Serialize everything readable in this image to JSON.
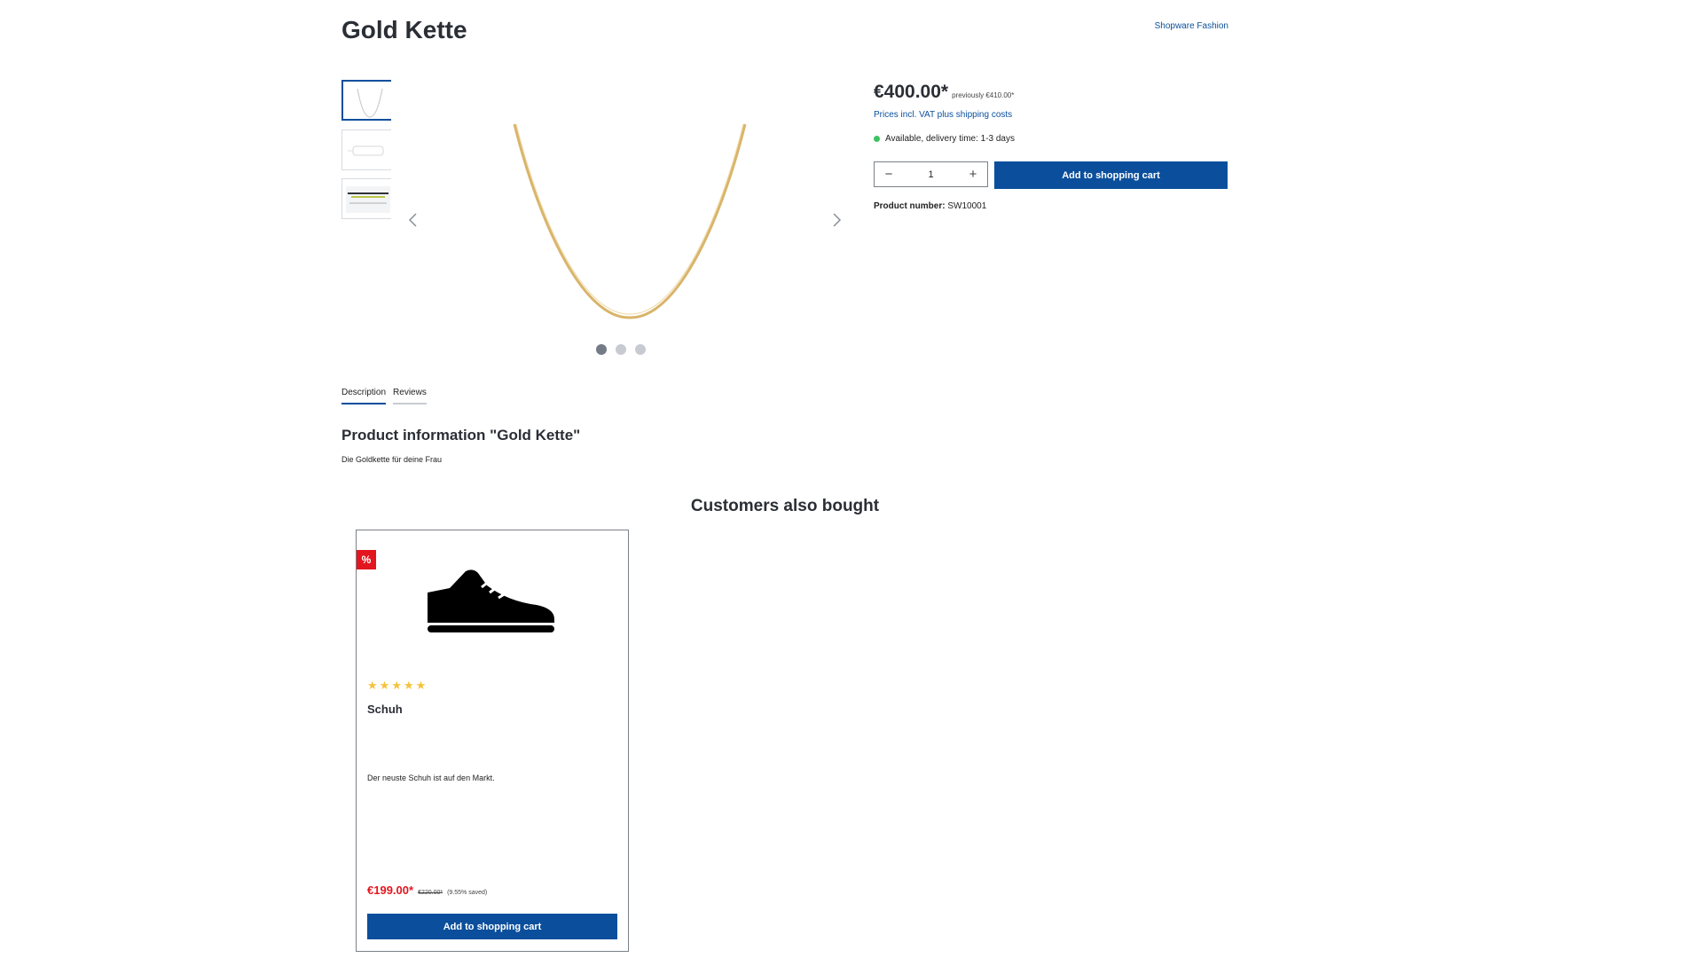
{
  "product": {
    "title": "Gold Kette",
    "manufacturer": "Shopware Fashion",
    "price": "€400.00*",
    "previous_price": "previously €410.00*",
    "vat_text": "Prices incl. VAT plus shipping costs",
    "delivery": "Available, delivery time: 1-3 days",
    "quantity": "1",
    "buy_label": "Add to shopping cart",
    "product_number_label": "Product number:",
    "product_number": "SW10001"
  },
  "gallery": {
    "slide_count": 3,
    "active_index": 0
  },
  "tabs": [
    {
      "label": "Description"
    },
    {
      "label": "Reviews"
    }
  ],
  "description": {
    "title": "Product information \"Gold Kette\"",
    "text": "Die Goldkette für deine Frau"
  },
  "cross_selling": {
    "title": "Customers also bought",
    "items": [
      {
        "badge": "%",
        "rating": 5,
        "name": "Schuh",
        "description": "Der neuste Schuh ist auf den Markt.",
        "price": "€199.00*",
        "old_price": "€220.00*",
        "saved": "(9.55% saved)",
        "button_label": "Add to shopping cart"
      }
    ]
  },
  "colors": {
    "primary": "#0b4f9c",
    "sale_red": "#e3161f",
    "available_green": "#3cc261",
    "star_yellow": "#f5c33b"
  },
  "icons": {
    "gallery_prev": "chevron-left-icon",
    "gallery_next": "chevron-right-icon",
    "quantity_minus": "minus-icon",
    "quantity_plus": "plus-icon",
    "rating": "star-icon"
  }
}
